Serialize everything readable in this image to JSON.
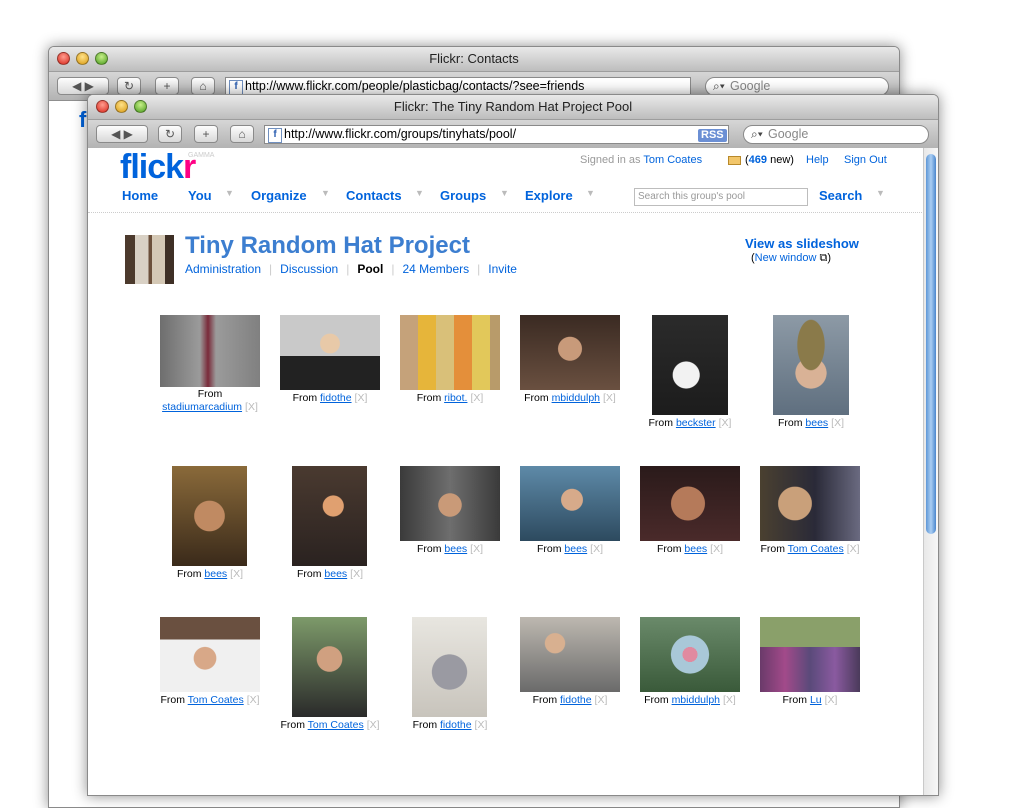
{
  "back_window": {
    "title": "Flickr: Contacts",
    "url": "http://www.flickr.com/people/plasticbag/contacts/?see=friends",
    "search_placeholder": "Google",
    "peek_text": "f"
  },
  "front_window": {
    "title": "Flickr: The Tiny Random Hat Project Pool",
    "url": "http://www.flickr.com/groups/tinyhats/pool/",
    "rss": "RSS",
    "search_placeholder": "Google"
  },
  "header": {
    "logo_left": "flick",
    "logo_right": "r",
    "gamma": "GAMMA",
    "signed_in_prefix": "Signed in as",
    "user": "Tom Coates",
    "mail_count": "469",
    "mail_suffix": "new)",
    "mail_prefix": "(",
    "help": "Help",
    "sign_out": "Sign Out"
  },
  "nav": {
    "home": "Home",
    "you": "You",
    "organize": "Organize",
    "contacts": "Contacts",
    "groups": "Groups",
    "explore": "Explore",
    "search_placeholder": "Search this group's pool",
    "search_button": "Search"
  },
  "group": {
    "title": "Tiny Random Hat Project",
    "links": [
      "Administration",
      "Discussion",
      "Pool",
      "24 Members",
      "Invite"
    ],
    "slideshow": "View as slideshow",
    "new_window_open": "(",
    "new_window": "New window",
    "new_window_close": ")"
  },
  "photos": [
    {
      "from": "From",
      "user": "stadiumarcadium",
      "x": "[X]"
    },
    {
      "from": "From",
      "user": "fidothe",
      "x": "[X]"
    },
    {
      "from": "From",
      "user": "ribot.",
      "x": "[X]"
    },
    {
      "from": "From",
      "user": "mbiddulph",
      "x": "[X]"
    },
    {
      "from": "From",
      "user": "beckster",
      "x": "[X]"
    },
    {
      "from": "From",
      "user": "bees",
      "x": "[X]"
    },
    {
      "from": "From",
      "user": "bees",
      "x": "[X]"
    },
    {
      "from": "From",
      "user": "bees",
      "x": "[X]"
    },
    {
      "from": "From",
      "user": "bees",
      "x": "[X]"
    },
    {
      "from": "From",
      "user": "bees",
      "x": "[X]"
    },
    {
      "from": "From",
      "user": "bees",
      "x": "[X]"
    },
    {
      "from": "From",
      "user": "Tom Coates",
      "x": "[X]"
    },
    {
      "from": "From",
      "user": "Tom Coates",
      "x": "[X]"
    },
    {
      "from": "From",
      "user": "Tom Coates",
      "x": "[X]"
    },
    {
      "from": "From",
      "user": "fidothe",
      "x": "[X]"
    },
    {
      "from": "From",
      "user": "fidothe",
      "x": "[X]"
    },
    {
      "from": "From",
      "user": "mbiddulph",
      "x": "[X]"
    },
    {
      "from": "From",
      "user": "Lu",
      "x": "[X]"
    }
  ],
  "colors": {
    "flickr_blue": "#0063dc",
    "flickr_pink": "#ff0084"
  }
}
